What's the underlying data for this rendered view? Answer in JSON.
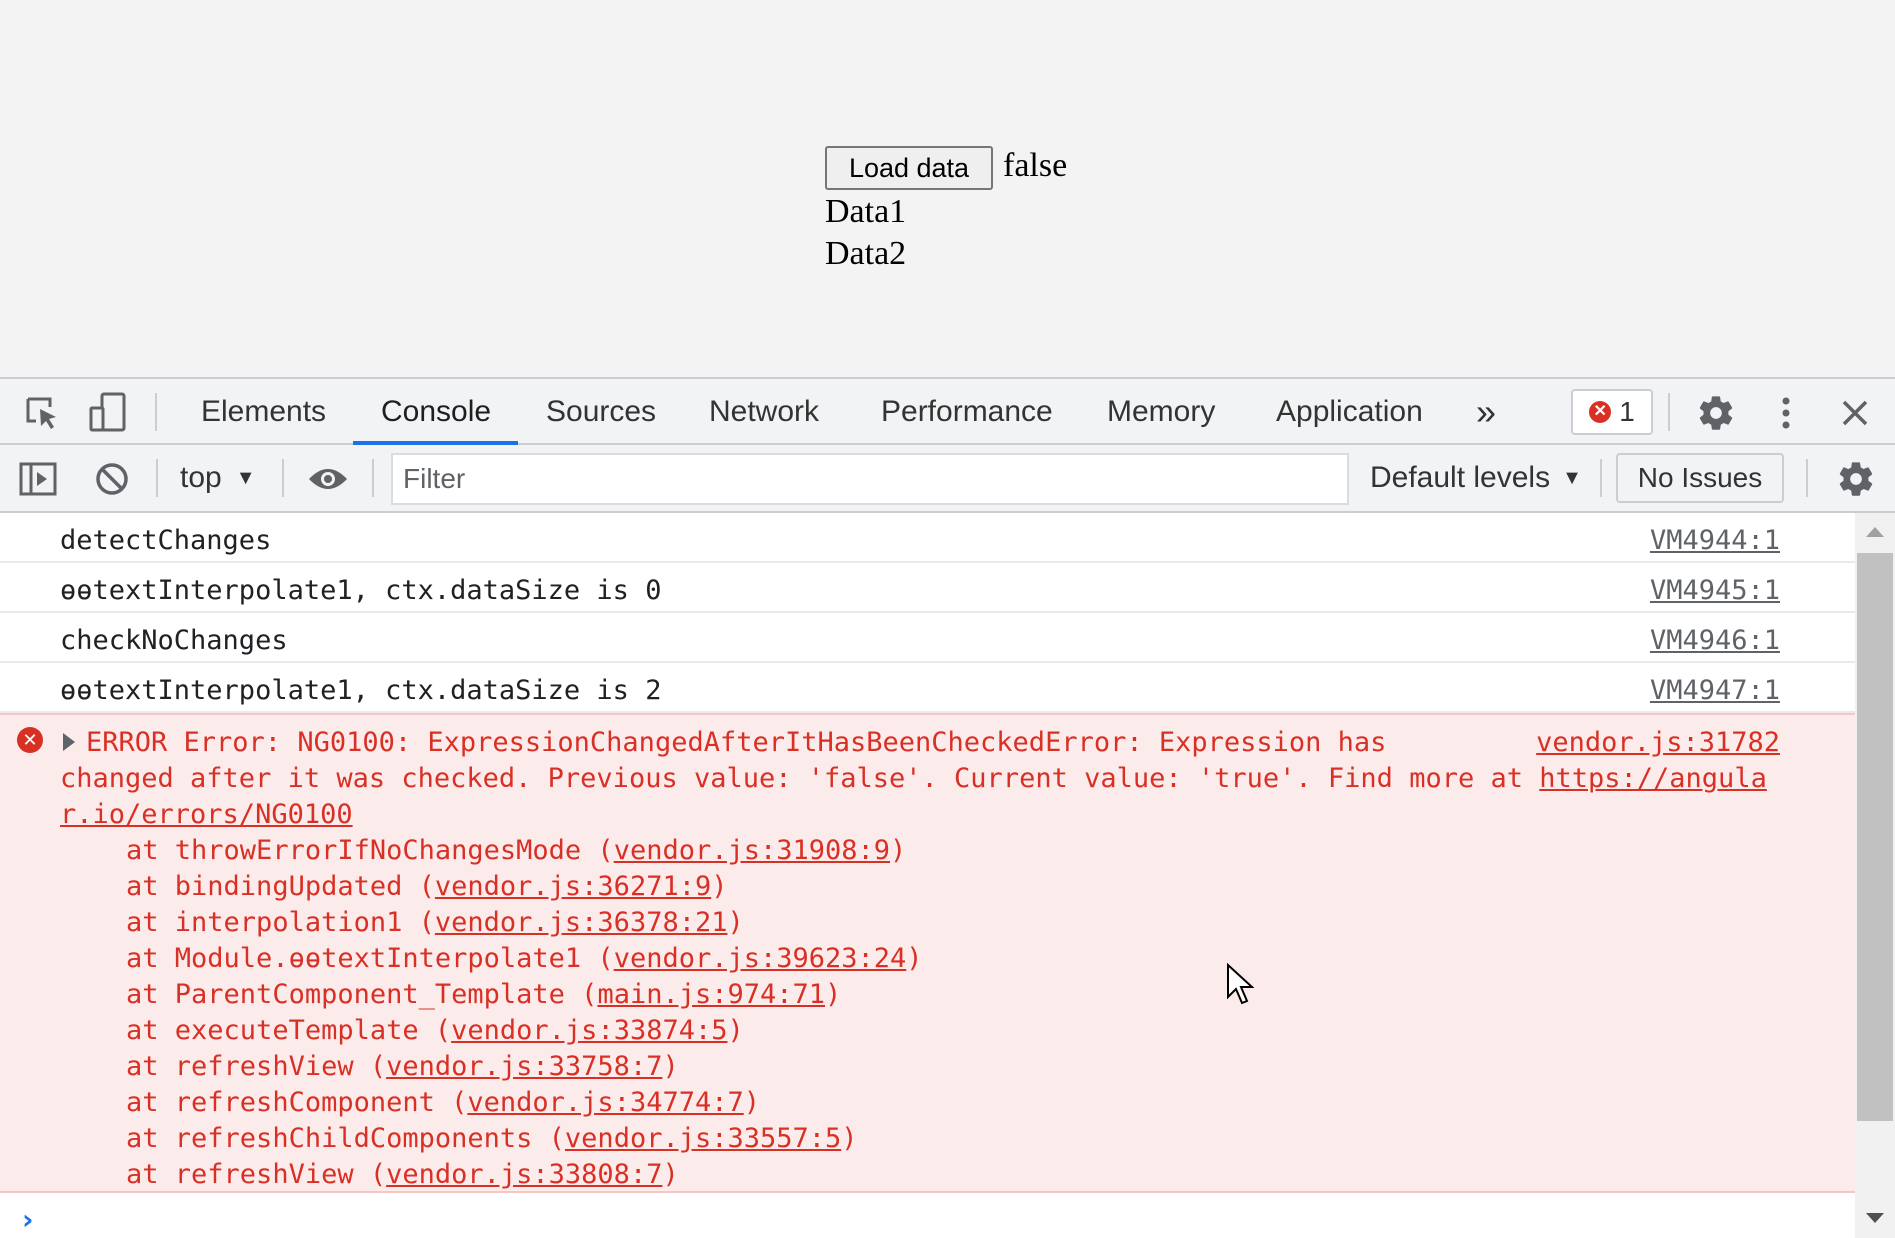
{
  "page": {
    "load_button": "Load data",
    "flag_value": "false",
    "items": [
      "Data1",
      "Data2"
    ]
  },
  "devtools": {
    "tabs": [
      "Elements",
      "Console",
      "Sources",
      "Network",
      "Performance",
      "Memory",
      "Application"
    ],
    "active_tab": "Console",
    "more_tabs_label": "»",
    "error_count": "1",
    "icons": [
      "inspect-element-icon",
      "device-toolbar-icon",
      "settings-icon",
      "kebab-menu-icon",
      "close-icon"
    ]
  },
  "console_toolbar": {
    "context": "top",
    "filter_placeholder": "Filter",
    "levels": "Default levels",
    "issues": "No Issues"
  },
  "messages": [
    {
      "text": "detectChanges",
      "source": "VM4944:1"
    },
    {
      "text": "ɵɵtextInterpolate1, ctx.dataSize is 0",
      "source": "VM4945:1"
    },
    {
      "text": "checkNoChanges",
      "source": "VM4946:1"
    },
    {
      "text": "ɵɵtextInterpolate1, ctx.dataSize is 2",
      "source": "VM4947:1"
    }
  ],
  "error": {
    "source": "vendor.js:31782",
    "line1": "ERROR Error: NG0100: ExpressionChangedAfterItHasBeenCheckedError: Expression has",
    "line2_prefix": "changed after it was checked. Previous value: 'false'. Current value: 'true'. Find more at ",
    "link_part1": "https://angula",
    "link_part2": "r.io/errors/NG0100",
    "stack": [
      {
        "fn": "throwErrorIfNoChangesMode",
        "loc": "vendor.js:31908:9"
      },
      {
        "fn": "bindingUpdated",
        "loc": "vendor.js:36271:9"
      },
      {
        "fn": "interpolation1",
        "loc": "vendor.js:36378:21"
      },
      {
        "fn": "Module.ɵɵtextInterpolate1",
        "loc": "vendor.js:39623:24"
      },
      {
        "fn": "ParentComponent_Template",
        "loc": "main.js:974:71"
      },
      {
        "fn": "executeTemplate",
        "loc": "vendor.js:33874:5"
      },
      {
        "fn": "refreshView",
        "loc": "vendor.js:33758:7"
      },
      {
        "fn": "refreshComponent",
        "loc": "vendor.js:34774:7"
      },
      {
        "fn": "refreshChildComponents",
        "loc": "vendor.js:33557:5"
      },
      {
        "fn": "refreshView",
        "loc": "vendor.js:33808:7"
      }
    ]
  },
  "colors": {
    "accent": "#1a73e8",
    "error": "#d93025",
    "error_bg": "#fcebeb"
  }
}
